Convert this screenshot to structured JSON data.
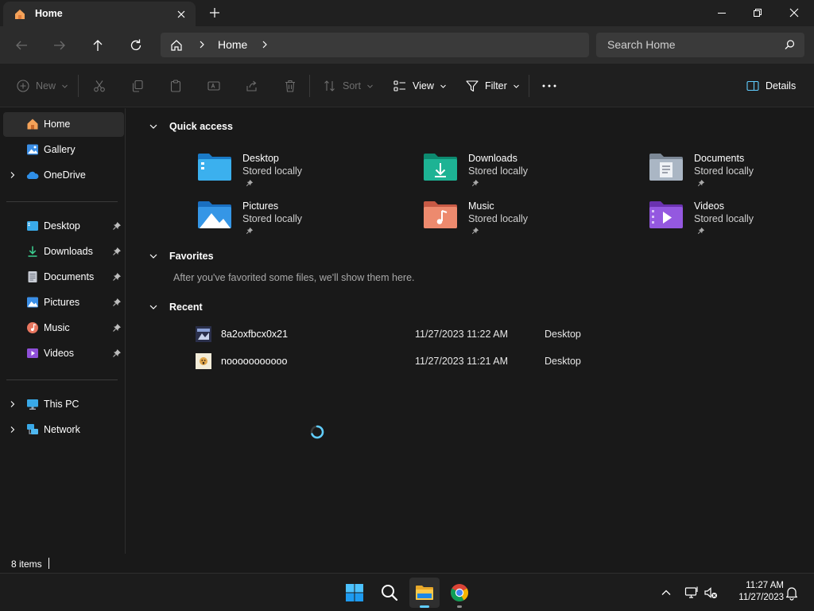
{
  "window": {
    "tab_title": "Home",
    "icons": {
      "tab": "home-folder-icon",
      "close_tab": "close-icon",
      "new_tab": "plus-icon"
    }
  },
  "nav": {
    "address_segments": [
      "Home"
    ],
    "search_placeholder": "Search Home"
  },
  "toolbar": {
    "new_label": "New",
    "sort_label": "Sort",
    "view_label": "View",
    "filter_label": "Filter",
    "details_label": "Details"
  },
  "sidebar": {
    "top": [
      {
        "label": "Home",
        "icon": "home-icon"
      },
      {
        "label": "Gallery",
        "icon": "gallery-icon"
      },
      {
        "label": "OneDrive",
        "icon": "onedrive-icon"
      }
    ],
    "pinned": [
      {
        "label": "Desktop",
        "icon": "desktop-folder-icon"
      },
      {
        "label": "Downloads",
        "icon": "downloads-folder-icon"
      },
      {
        "label": "Documents",
        "icon": "documents-folder-icon"
      },
      {
        "label": "Pictures",
        "icon": "pictures-folder-icon"
      },
      {
        "label": "Music",
        "icon": "music-folder-icon"
      },
      {
        "label": "Videos",
        "icon": "videos-folder-icon"
      }
    ],
    "bottom": [
      {
        "label": "This PC",
        "icon": "this-pc-icon"
      },
      {
        "label": "Network",
        "icon": "network-icon"
      }
    ]
  },
  "main": {
    "quick_access": {
      "title": "Quick access",
      "items": [
        {
          "name": "Desktop",
          "status": "Stored locally"
        },
        {
          "name": "Downloads",
          "status": "Stored locally"
        },
        {
          "name": "Documents",
          "status": "Stored locally"
        },
        {
          "name": "Pictures",
          "status": "Stored locally"
        },
        {
          "name": "Music",
          "status": "Stored locally"
        },
        {
          "name": "Videos",
          "status": "Stored locally"
        }
      ]
    },
    "favorites": {
      "title": "Favorites",
      "empty_message": "After you've favorited some files, we'll show them here."
    },
    "recent": {
      "title": "Recent",
      "items": [
        {
          "name": "8a2oxfbcx0x21",
          "date": "11/27/2023 11:22 AM",
          "location": "Desktop"
        },
        {
          "name": "nooooooooooo",
          "date": "11/27/2023 11:21 AM",
          "location": "Desktop"
        }
      ]
    }
  },
  "status": {
    "item_count": "8 items"
  },
  "taskbar": {
    "time": "11:27 AM",
    "date": "11/27/2023",
    "apps": [
      "start-icon",
      "search-icon",
      "file-explorer-icon",
      "chrome-icon"
    ]
  },
  "colors": {
    "accent": "#60cdff",
    "background": "#191919",
    "titlebar": "#202020",
    "panel": "#2c2c2c"
  }
}
